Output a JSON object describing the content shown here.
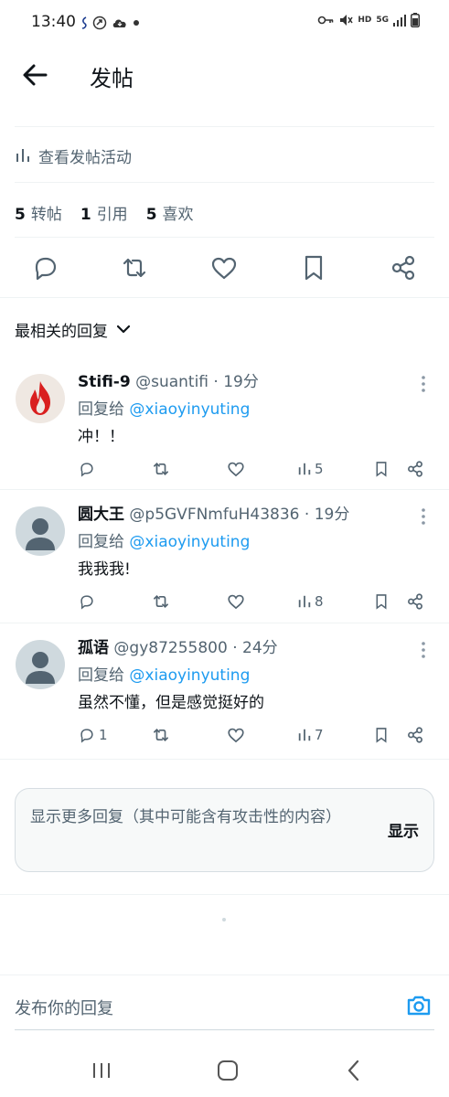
{
  "status_bar": {
    "time": "13:40",
    "left_icons": [
      "signal-hook-icon",
      "vpn-icon",
      "cloud-icon",
      "dot-icon"
    ],
    "right_icons": [
      "key-icon",
      "mute-icon",
      "hd-icon",
      "5g-icon",
      "signal-bars-icon",
      "battery-icon"
    ],
    "hd_label": "HD",
    "net_label": "5G"
  },
  "header": {
    "title": "发帖",
    "back_icon": "arrow-left-icon"
  },
  "post_activity": {
    "label": "查看发帖活动",
    "icon": "bar-chart-icon"
  },
  "stats": {
    "reposts_count": "5",
    "reposts_label": "转帖",
    "quotes_count": "1",
    "quotes_label": "引用",
    "likes_count": "5",
    "likes_label": "喜欢"
  },
  "sort": {
    "label": "最相关的回复",
    "icon": "chevron-down-icon"
  },
  "reply_prefix": "回复给",
  "replies": [
    {
      "name": "Stifi-9",
      "handle": "@suantifi",
      "time": "· 19分",
      "reply_to": "@xiaoyinyuting",
      "text": "冲！！",
      "reply_count": "",
      "views": "5",
      "avatar": "flame-avatar"
    },
    {
      "name": "圆大王",
      "handle": "@p5GVFNmfuH43836",
      "time": "· 19分",
      "reply_to": "@xiaoyinyuting",
      "text": "我我我!",
      "reply_count": "",
      "views": "8",
      "avatar": "default-avatar"
    },
    {
      "name": "孤语",
      "handle": "@gy87255800",
      "time": "· 24分",
      "reply_to": "@xiaoyinyuting",
      "text": "虽然不懂，但是感觉挺好的",
      "reply_count": "1",
      "views": "7",
      "avatar": "default-avatar"
    }
  ],
  "more_replies": {
    "text": "显示更多回复（其中可能含有攻击性的内容）",
    "button": "显示"
  },
  "compose": {
    "placeholder": "发布你的回复",
    "icon": "camera-icon"
  },
  "nav": {
    "icons": [
      "recent-apps-icon",
      "home-icon",
      "back-icon"
    ]
  },
  "colors": {
    "accent": "#1d9bf0",
    "text": "#0f1419",
    "muted": "#536471",
    "divider": "#eff3f4"
  }
}
